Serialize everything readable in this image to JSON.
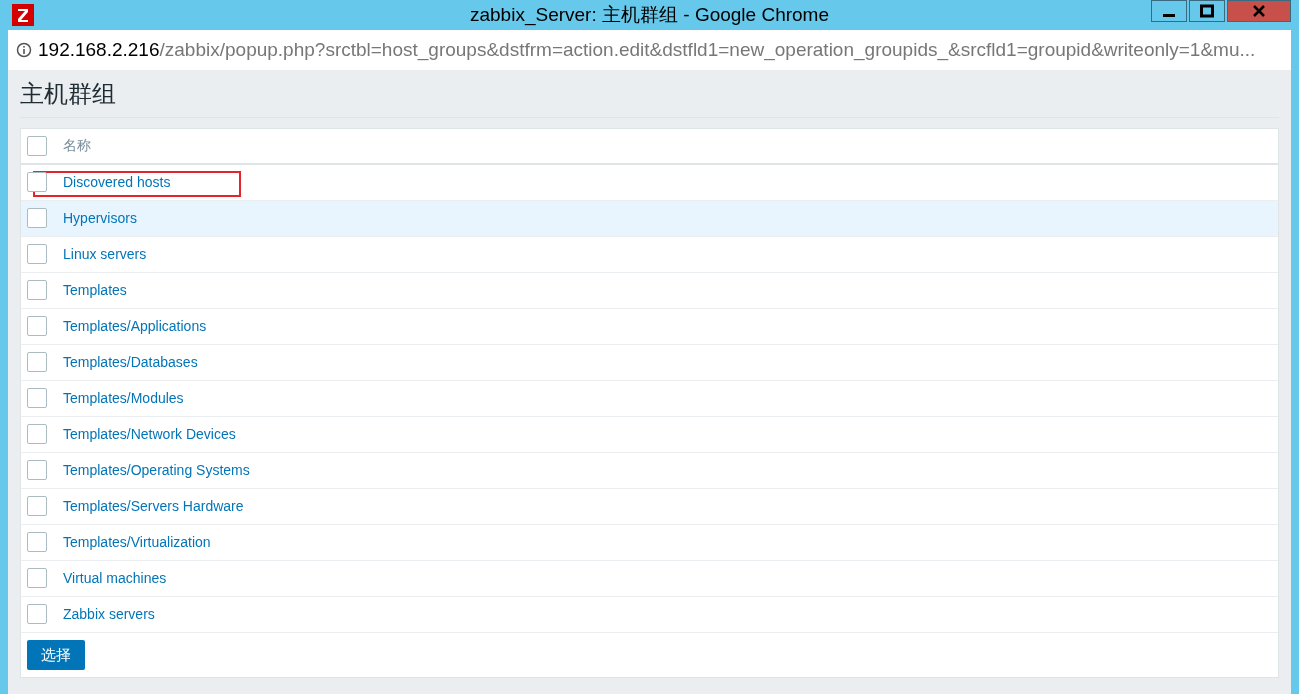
{
  "window": {
    "title": "zabbix_Server: 主机群组 - Google Chrome"
  },
  "address_bar": {
    "host": "192.168.2.216",
    "path": "/zabbix/popup.php?srctbl=host_groups&dstfrm=action.edit&dstfld1=new_operation_groupids_&srcfld1=groupid&writeonly=1&mu..."
  },
  "page": {
    "title": "主机群组"
  },
  "table": {
    "header": {
      "label": "名称",
      "checked": false
    },
    "rows": [
      {
        "name": "Discovered hosts",
        "checked": false,
        "hovered": false,
        "annotated": true
      },
      {
        "name": "Hypervisors",
        "checked": false,
        "hovered": true,
        "annotated": false
      },
      {
        "name": "Linux servers",
        "checked": false,
        "hovered": false,
        "annotated": false
      },
      {
        "name": "Templates",
        "checked": false,
        "hovered": false,
        "annotated": false
      },
      {
        "name": "Templates/Applications",
        "checked": false,
        "hovered": false,
        "annotated": false
      },
      {
        "name": "Templates/Databases",
        "checked": false,
        "hovered": false,
        "annotated": false
      },
      {
        "name": "Templates/Modules",
        "checked": false,
        "hovered": false,
        "annotated": false
      },
      {
        "name": "Templates/Network Devices",
        "checked": false,
        "hovered": false,
        "annotated": false
      },
      {
        "name": "Templates/Operating Systems",
        "checked": false,
        "hovered": false,
        "annotated": false
      },
      {
        "name": "Templates/Servers Hardware",
        "checked": false,
        "hovered": false,
        "annotated": false
      },
      {
        "name": "Templates/Virtualization",
        "checked": false,
        "hovered": false,
        "annotated": false
      },
      {
        "name": "Virtual machines",
        "checked": false,
        "hovered": false,
        "annotated": false
      },
      {
        "name": "Zabbix servers",
        "checked": false,
        "hovered": false,
        "annotated": false
      }
    ]
  },
  "select_button": {
    "label": "选择"
  }
}
